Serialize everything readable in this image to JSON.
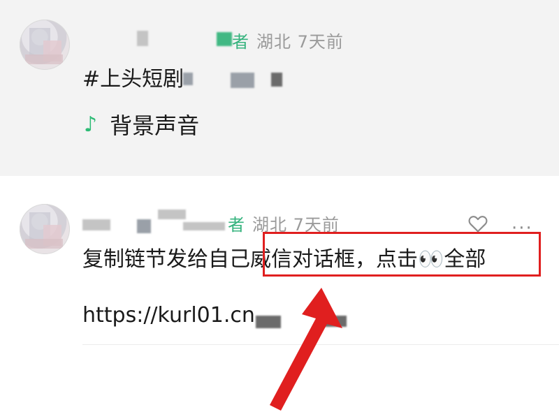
{
  "post1": {
    "author_suffix": "者",
    "location": "湖北",
    "time": "7天前",
    "hashtag": "#上头短剧",
    "music_icon": "music-note-icon",
    "music_label": "背景声音"
  },
  "post2": {
    "author_suffix": "者",
    "location": "湖北",
    "time": "7天前",
    "text": "复制链节发给自己威信对话框，点击👀全部",
    "link": "https://kurl01.cn",
    "like_icon": "heart-icon",
    "more_icon": "more-icon",
    "more_label": "···"
  },
  "annotation": {
    "highlight_color": "#e01f1f",
    "arrow_color": "#e01f1f"
  }
}
